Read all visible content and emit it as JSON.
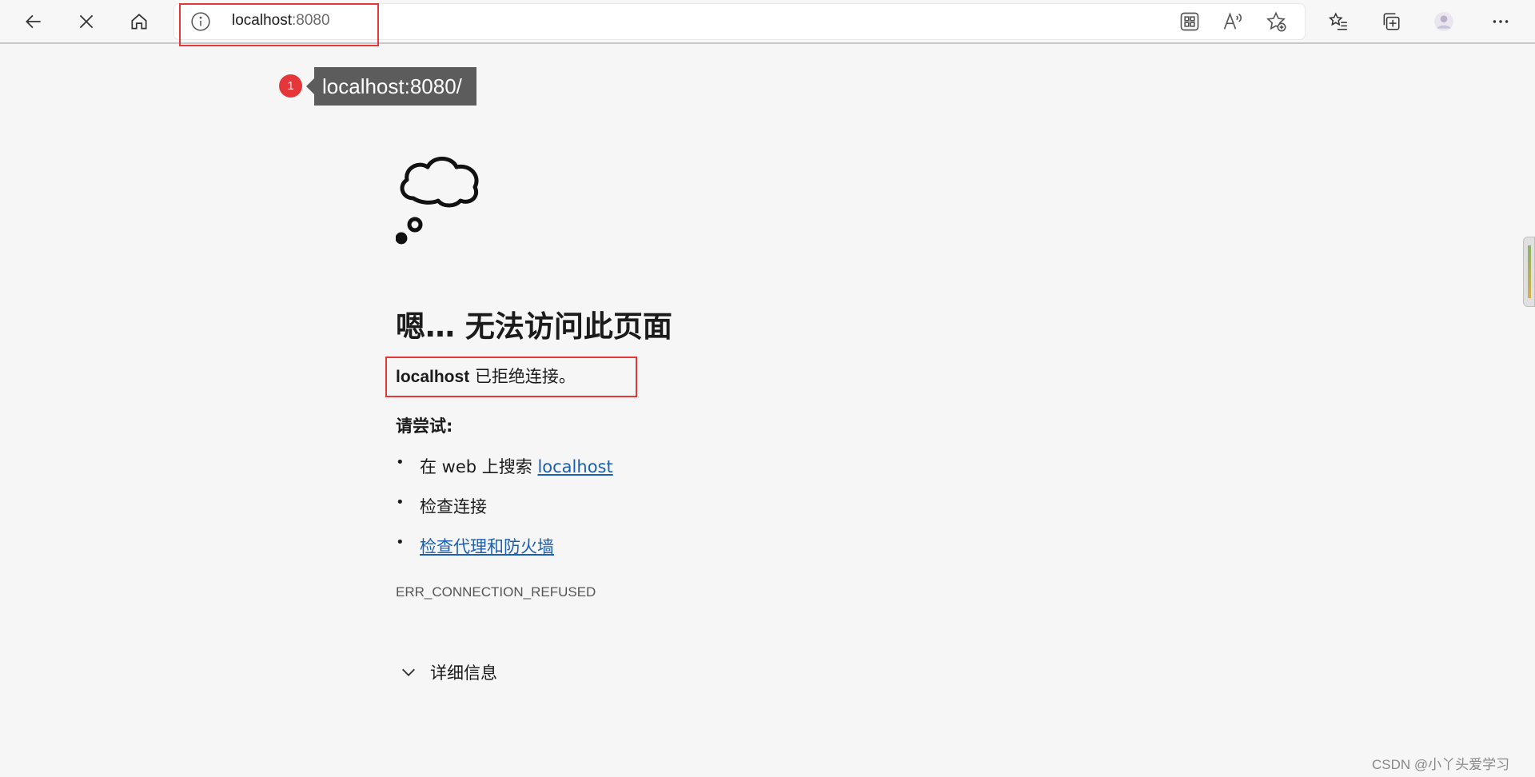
{
  "address_bar": {
    "host": "localhost",
    "port": ":8080"
  },
  "tooltip": {
    "badge": "1",
    "text": "localhost:8080/"
  },
  "error": {
    "title": "嗯… 无法访问此页面",
    "host_bold": "localhost",
    "host_message": " 已拒绝连接。",
    "try_label": "请尝试:",
    "tip_search_prefix": "在 web 上搜索 ",
    "tip_search_link": "localhost",
    "tip_check_connection": "检查连接",
    "tip_proxy_link": "检查代理和防火墙",
    "code": "ERR_CONNECTION_REFUSED",
    "details_label": "详细信息"
  },
  "watermark": "CSDN @小丫头爱学习",
  "colors": {
    "annotation_red": "#e5363a",
    "link_blue": "#1a5fb4",
    "page_bg": "#f6f6f6"
  }
}
